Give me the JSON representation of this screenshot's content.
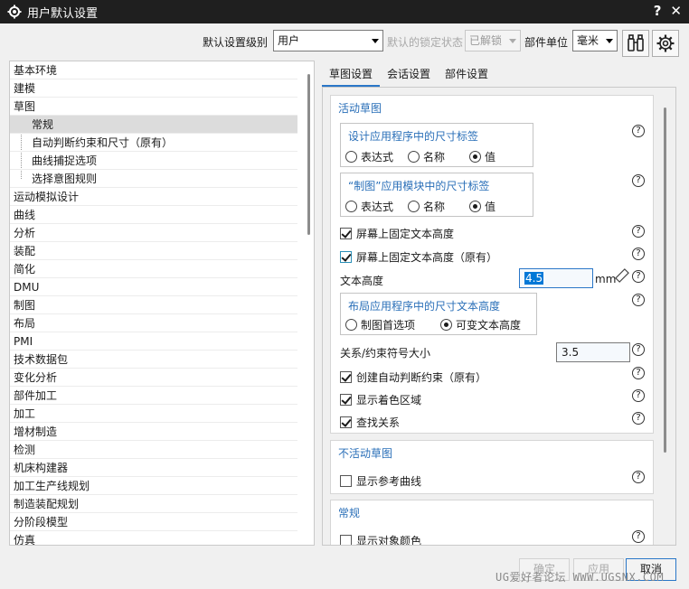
{
  "window": {
    "title": "用户默认设置",
    "help": "?",
    "close": "✕"
  },
  "toolbar": {
    "level_label": "默认设置级别",
    "level_value": "用户",
    "lock_label": "默认的锁定状态",
    "lock_value": "已解锁",
    "unit_label": "部件单位",
    "unit_value": "毫米"
  },
  "tree": {
    "items": [
      {
        "label": "基本环境"
      },
      {
        "label": "建模"
      },
      {
        "label": "草图"
      },
      {
        "label": "常规"
      },
      {
        "label": "自动判断约束和尺寸（原有）"
      },
      {
        "label": "曲线捕捉选项"
      },
      {
        "label": "选择意图规则"
      },
      {
        "label": "运动模拟设计"
      },
      {
        "label": "曲线"
      },
      {
        "label": "分析"
      },
      {
        "label": "装配"
      },
      {
        "label": "简化"
      },
      {
        "label": "DMU"
      },
      {
        "label": "制图"
      },
      {
        "label": "布局"
      },
      {
        "label": "PMI"
      },
      {
        "label": "技术数据包"
      },
      {
        "label": "变化分析"
      },
      {
        "label": "部件加工"
      },
      {
        "label": "加工"
      },
      {
        "label": "增材制造"
      },
      {
        "label": "检测"
      },
      {
        "label": "机床构建器"
      },
      {
        "label": "加工生产线规划"
      },
      {
        "label": "制造装配规划"
      },
      {
        "label": "分阶段模型"
      },
      {
        "label": "仿真"
      }
    ]
  },
  "tabs": [
    {
      "label": "草图设置"
    },
    {
      "label": "会话设置"
    },
    {
      "label": "部件设置"
    }
  ],
  "active_sketch": {
    "title": "活动草图",
    "dim_label_group": {
      "title": "设计应用程序中的尺寸标签",
      "options": [
        "表达式",
        "名称",
        "值"
      ],
      "selected": "值"
    },
    "drafting_group": {
      "title": "“制图”应用模块中的尺寸标签",
      "options": [
        "表达式",
        "名称",
        "值"
      ],
      "selected": "值"
    },
    "fix_text_height": "屏幕上固定文本高度",
    "fix_text_height_legacy": "屏幕上固定文本高度（原有）",
    "text_height_label": "文本高度",
    "text_height_value": "4.5",
    "text_height_unit": "mm",
    "layout_group": {
      "title": "布局应用程序中的尺寸文本高度",
      "options": [
        "制图首选项",
        "可变文本高度"
      ],
      "selected": "可变文本高度"
    },
    "symbol_size_label": "关系/约束符号大小",
    "symbol_size_value": "3.5",
    "create_inferred": "创建自动判断约束（原有）",
    "show_shaded": "显示着色区域",
    "find_relations": "查找关系"
  },
  "inactive_sketch": {
    "title": "不活动草图",
    "show_ref_curves": "显示参考曲线"
  },
  "general": {
    "title": "常规",
    "show_object_color": "显示对象颜色"
  },
  "buttons": {
    "ok": "确定",
    "apply": "应用",
    "cancel": "取消"
  },
  "watermark": "UG爱好者论坛 WWW.UGSNX.COM",
  "help_glyph": "?"
}
